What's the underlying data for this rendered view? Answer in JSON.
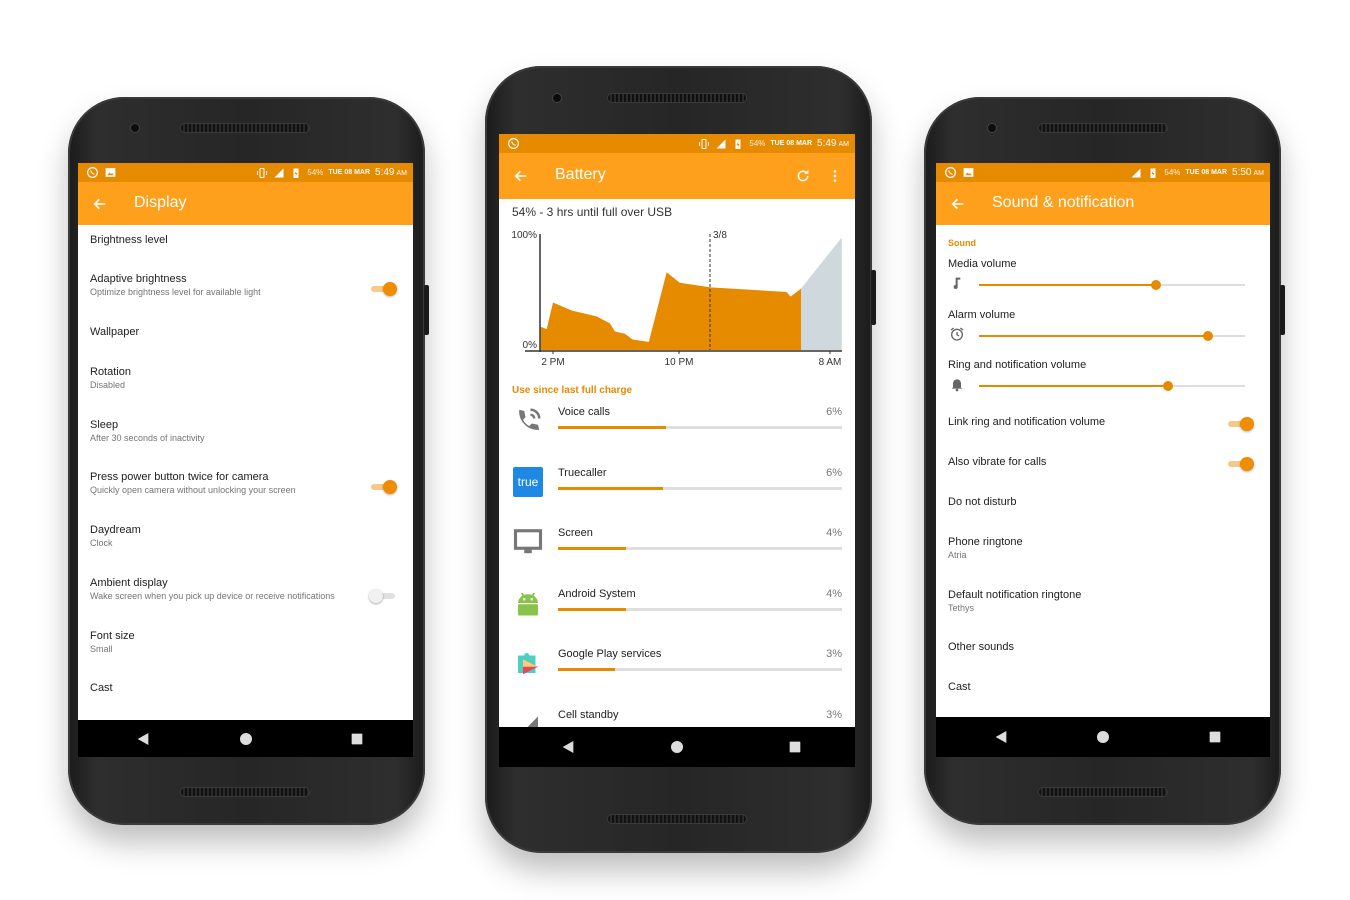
{
  "colors": {
    "accent": "#e68a00",
    "toolbar": "#ffa01c",
    "status_bar": "#e68a00",
    "projection": "#cfd8dc"
  },
  "phones": [
    {
      "status": {
        "battery": "54%",
        "date": "TUE 08 MAR",
        "time": "5:49",
        "ampm": "AM",
        "icons": [
          "whatsapp-icon",
          "image-icon",
          "vibrate-icon",
          "signal-icon",
          "battery-charging-icon"
        ]
      },
      "title": "Display",
      "items": [
        {
          "title": "Brightness level"
        },
        {
          "title": "Adaptive brightness",
          "subtitle": "Optimize brightness level for available light",
          "toggle": true
        },
        {
          "title": "Wallpaper"
        },
        {
          "title": "Rotation",
          "subtitle": "Disabled"
        },
        {
          "title": "Sleep",
          "subtitle": "After 30 seconds of inactivity"
        },
        {
          "title": "Press power button twice for camera",
          "subtitle": "Quickly open camera without unlocking your screen",
          "toggle": true
        },
        {
          "title": "Daydream",
          "subtitle": "Clock"
        },
        {
          "title": "Ambient display",
          "subtitle": "Wake screen when you pick up device or receive notifications",
          "toggle": false
        },
        {
          "title": "Font size",
          "subtitle": "Small"
        },
        {
          "title": "Cast"
        }
      ]
    },
    {
      "status": {
        "battery": "54%",
        "date": "TUE 08 MAR",
        "time": "5:49",
        "ampm": "AM",
        "icons": [
          "whatsapp-icon",
          "vibrate-icon",
          "signal-icon",
          "battery-charging-icon"
        ]
      },
      "title": "Battery",
      "summary": "54% - 3 hrs until full over USB",
      "chart": {
        "type": "area",
        "y_labels": [
          "100%",
          "0%"
        ],
        "x_ticks": [
          "2 PM",
          "10 PM",
          "8 AM"
        ],
        "marker": "3/8",
        "history": [
          [
            "13:13",
            20
          ],
          [
            "13:36",
            18
          ],
          [
            "14:00",
            41
          ],
          [
            "15:11",
            34
          ],
          [
            "16:46",
            29
          ],
          [
            "17:37",
            23
          ],
          [
            "17:56",
            16
          ],
          [
            "18:34",
            14
          ],
          [
            "19:03",
            9
          ],
          [
            "20:05",
            7
          ],
          [
            "21:13",
            67
          ],
          [
            "22:03",
            58
          ],
          [
            "00:00",
            54
          ],
          [
            "04:50",
            50
          ],
          [
            "05:05",
            46
          ],
          [
            "05:45",
            53
          ]
        ],
        "projection": [
          [
            "05:45",
            53
          ],
          [
            "08:20",
            97
          ]
        ]
      },
      "section": "Use since last full charge",
      "usage": [
        {
          "name": "Voice calls",
          "percent": "6%",
          "bar": 0.38,
          "icon": "phone-call-icon"
        },
        {
          "name": "Truecaller",
          "percent": "6%",
          "bar": 0.37,
          "icon": "truecaller-icon",
          "icon_text": "true"
        },
        {
          "name": "Screen",
          "percent": "4%",
          "bar": 0.24,
          "icon": "monitor-icon"
        },
        {
          "name": "Android System",
          "percent": "4%",
          "bar": 0.24,
          "icon": "android-icon"
        },
        {
          "name": "Google Play services",
          "percent": "3%",
          "bar": 0.2,
          "icon": "puzzle-icon"
        },
        {
          "name": "Cell standby",
          "percent": "3%",
          "icon": "signal-icon"
        }
      ]
    },
    {
      "status": {
        "battery": "54%",
        "date": "TUE 08 MAR",
        "time": "5:50",
        "ampm": "AM",
        "icons": [
          "whatsapp-icon",
          "image-icon",
          "signal-icon",
          "battery-charging-icon"
        ]
      },
      "title": "Sound & notification",
      "section": "Sound",
      "volumes": [
        {
          "label": "Media volume",
          "level": 0.665,
          "icon": "music-note-icon"
        },
        {
          "label": "Alarm volume",
          "level": 0.86,
          "icon": "alarm-icon"
        },
        {
          "label": "Ring and notification volume",
          "level": 0.71,
          "icon": "bell-icon"
        }
      ],
      "items": [
        {
          "title": "Link ring and notification volume",
          "toggle": true
        },
        {
          "title": "Also vibrate for calls",
          "toggle": true
        },
        {
          "title": "Do not disturb"
        },
        {
          "title": "Phone ringtone",
          "subtitle": "Atria"
        },
        {
          "title": "Default notification ringtone",
          "subtitle": "Tethys"
        },
        {
          "title": "Other sounds"
        },
        {
          "title": "Cast"
        }
      ]
    }
  ]
}
